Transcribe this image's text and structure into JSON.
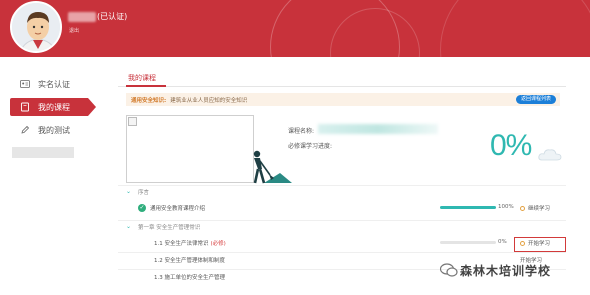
{
  "header": {
    "verified_label": "(已认证)",
    "logout_label": "退出"
  },
  "sidebar": {
    "items": [
      {
        "label": "实名认证",
        "icon": "id-card-icon"
      },
      {
        "label": "我的课程",
        "icon": "book-icon",
        "active": true
      },
      {
        "label": "我的测试",
        "icon": "pencil-icon"
      }
    ]
  },
  "main": {
    "tab": "我的课程",
    "notice": {
      "title": "通用安全知识:",
      "text": "建筑业从业人员应知的安全知识",
      "button": "返回课程列表"
    },
    "course": {
      "name_label": "课程名称:",
      "progress_label": "必修课学习进度:",
      "progress_percent": "0%"
    },
    "chapters": [
      {
        "title": "序言",
        "lessons": [
          {
            "title": "通用安全教育课程介绍",
            "required": "",
            "done": true,
            "progress": 1.0,
            "percent": "100%",
            "action": "继续学习"
          }
        ]
      },
      {
        "title": "第一章 安全生产管理常识",
        "lessons": [
          {
            "title": "1.1 安全生产法律常识",
            "required": "(必修)",
            "done": false,
            "progress": 0,
            "percent": "0%",
            "action": "开始学习",
            "highlight": true
          },
          {
            "title": "1.2 安全生产管理体制和制度",
            "required": "",
            "done": false,
            "progress": 0,
            "percent": "",
            "action": "开始学习"
          },
          {
            "title": "1.3 施工单位的安全生产管理",
            "required": "",
            "done": false,
            "progress": 0,
            "percent": "",
            "action": ""
          }
        ]
      }
    ]
  },
  "watermark": "森林木培训学校",
  "colors": {
    "brand_red": "#c8323b",
    "teal": "#2fb8b1",
    "blue": "#1c7fd8",
    "green": "#2fae7d",
    "orange": "#e3a243"
  }
}
